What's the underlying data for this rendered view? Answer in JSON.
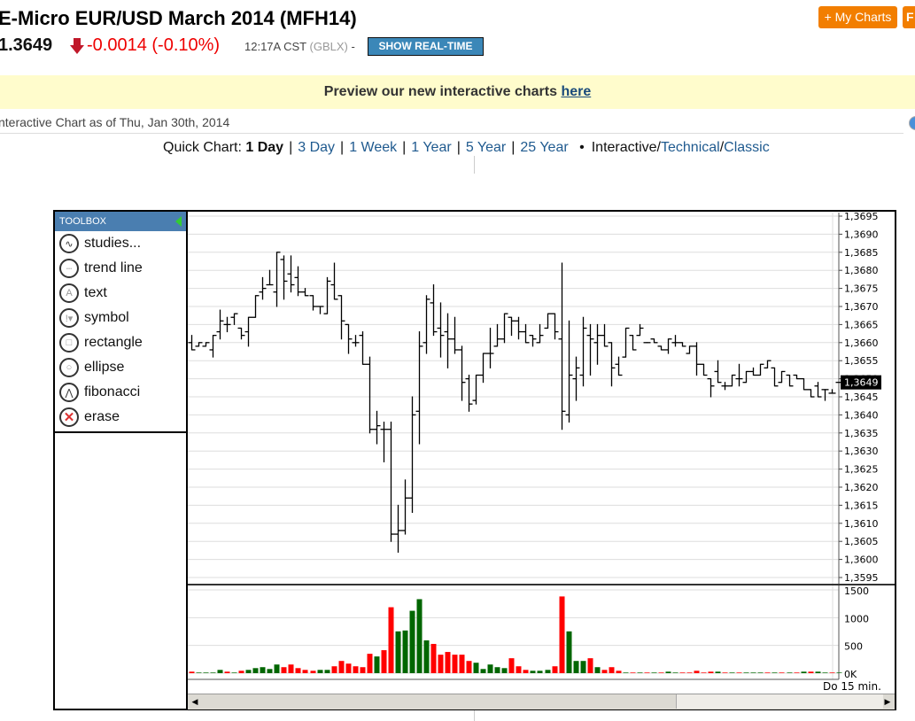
{
  "header": {
    "title": "E-Micro EUR/USD March 2014 (MFH14)",
    "last": "1.3649",
    "change": "-0.0014 (-0.10%)",
    "time": "12:17A CST",
    "exchange": "(GBLX)",
    "dash": "-",
    "realtime_button": "SHOW REAL-TIME",
    "my_charts": "+ My Charts",
    "other_button": "F"
  },
  "banner": {
    "text": "Preview our new interactive charts ",
    "link": "here"
  },
  "as_of": "nteractive Chart as of Thu, Jan 30th, 2014",
  "quick": {
    "label": "Quick Chart:",
    "active": "1 Day",
    "links": [
      "3 Day",
      "1 Week",
      "1 Year",
      "5 Year",
      "25 Year"
    ],
    "bullet": "•",
    "interactive": "Interactive",
    "technical": "Technical",
    "classic": "Classic",
    "slash": "/",
    "bar": "|"
  },
  "toolbox": {
    "title": "TOOLBOX",
    "items": [
      {
        "label": "studies...",
        "icon": "studies-icon"
      },
      {
        "label": "trend line",
        "icon": "trend-line-icon"
      },
      {
        "label": "text",
        "icon": "text-icon"
      },
      {
        "label": "symbol",
        "icon": "symbol-icon"
      },
      {
        "label": "rectangle",
        "icon": "rectangle-icon"
      },
      {
        "label": "ellipse",
        "icon": "ellipse-icon"
      },
      {
        "label": "fibonacci",
        "icon": "fibonacci-icon"
      },
      {
        "label": "erase",
        "icon": "erase-icon"
      }
    ]
  },
  "footer": {
    "label": "Do  15 min."
  },
  "colors": {
    "up": "#006600",
    "down": "#ff0000",
    "accent": "#f27e00"
  },
  "chart_data": {
    "type": "ohlc",
    "interval": "15 min.",
    "price_ticks": [
      "1,3695",
      "1,3690",
      "1,3685",
      "1,3680",
      "1,3675",
      "1,3670",
      "1,3665",
      "1,3660",
      "1,3655",
      "1,3650",
      "1,3645",
      "1,3640",
      "1,3635",
      "1,3630",
      "1,3625",
      "1,3620",
      "1,3615",
      "1,3610",
      "1,3605",
      "1,3600",
      "1,3595"
    ],
    "ylim": [
      1.3595,
      1.3695
    ],
    "current_label": "1,3649",
    "current": 1.3649,
    "volume_ticks": [
      "1500",
      "1000",
      "500",
      "0K"
    ],
    "volume_ylim": [
      0,
      1500
    ],
    "ohlc": [
      [
        1.366,
        1.3662,
        1.3658,
        1.3658
      ],
      [
        1.3659,
        1.366,
        1.3659,
        1.366
      ],
      [
        1.3659,
        1.366,
        1.3659,
        1.366
      ],
      [
        1.3658,
        1.3662,
        1.3656,
        1.3662
      ],
      [
        1.3663,
        1.3669,
        1.3661,
        1.3666
      ],
      [
        1.3665,
        1.3667,
        1.3663,
        1.3665
      ],
      [
        1.3667,
        1.3668,
        1.3665,
        1.3668
      ],
      [
        1.3664,
        1.3664,
        1.3661,
        1.3662
      ],
      [
        1.3663,
        1.3667,
        1.3659,
        1.3667
      ],
      [
        1.3667,
        1.3673,
        1.3667,
        1.3673
      ],
      [
        1.3674,
        1.3678,
        1.3672,
        1.3675
      ],
      [
        1.3676,
        1.368,
        1.3676,
        1.3676
      ],
      [
        1.3674,
        1.3685,
        1.367,
        1.3685
      ],
      [
        1.3683,
        1.3684,
        1.3672,
        1.3677
      ],
      [
        1.3679,
        1.3684,
        1.3674,
        1.3676
      ],
      [
        1.3678,
        1.3681,
        1.3673,
        1.3674
      ],
      [
        1.3674,
        1.3675,
        1.3673,
        1.3673
      ],
      [
        1.3673,
        1.3673,
        1.3669,
        1.367
      ],
      [
        1.367,
        1.367,
        1.3668,
        1.367
      ],
      [
        1.3668,
        1.3678,
        1.3668,
        1.3677
      ],
      [
        1.3676,
        1.3682,
        1.3672,
        1.3672
      ],
      [
        1.3673,
        1.3673,
        1.3661,
        1.3666
      ],
      [
        1.3665,
        1.3665,
        1.3657,
        1.3661
      ],
      [
        1.366,
        1.3662,
        1.3659,
        1.366
      ],
      [
        1.3662,
        1.3663,
        1.3654,
        1.3654
      ],
      [
        1.3654,
        1.3656,
        1.3635,
        1.3636
      ],
      [
        1.3636,
        1.3641,
        1.3632,
        1.3637
      ],
      [
        1.3636,
        1.3638,
        1.3627,
        1.3636
      ],
      [
        1.3636,
        1.3638,
        1.3605,
        1.3607
      ],
      [
        1.3607,
        1.3615,
        1.3602,
        1.3608
      ],
      [
        1.3608,
        1.3622,
        1.3607,
        1.3617
      ],
      [
        1.3617,
        1.3645,
        1.3613,
        1.364
      ],
      [
        1.3641,
        1.3663,
        1.3632,
        1.3659
      ],
      [
        1.366,
        1.3673,
        1.3657,
        1.3672
      ],
      [
        1.3671,
        1.3676,
        1.3662,
        1.3663
      ],
      [
        1.3664,
        1.3671,
        1.3656,
        1.3662
      ],
      [
        1.3663,
        1.3668,
        1.3653,
        1.3661
      ],
      [
        1.3661,
        1.3667,
        1.3657,
        1.3658
      ],
      [
        1.3658,
        1.3659,
        1.3644,
        1.3649
      ],
      [
        1.365,
        1.3651,
        1.3641,
        1.3643
      ],
      [
        1.3644,
        1.3651,
        1.3643,
        1.3651
      ],
      [
        1.3651,
        1.3657,
        1.3649,
        1.3657
      ],
      [
        1.3657,
        1.3664,
        1.3653,
        1.3657
      ],
      [
        1.3659,
        1.3665,
        1.3659,
        1.3661
      ],
      [
        1.3661,
        1.3668,
        1.366,
        1.3668
      ],
      [
        1.3667,
        1.3667,
        1.3662,
        1.3666
      ],
      [
        1.3666,
        1.3667,
        1.3661,
        1.3663
      ],
      [
        1.3663,
        1.3665,
        1.366,
        1.366
      ],
      [
        1.3662,
        1.3662,
        1.3659,
        1.3661
      ],
      [
        1.366,
        1.3665,
        1.366,
        1.3662
      ],
      [
        1.3664,
        1.3668,
        1.3664,
        1.3668
      ],
      [
        1.3668,
        1.3668,
        1.3661,
        1.3663
      ],
      [
        1.3661,
        1.3682,
        1.3636,
        1.3641
      ],
      [
        1.364,
        1.3666,
        1.3638,
        1.3651
      ],
      [
        1.365,
        1.3656,
        1.3644,
        1.3653
      ],
      [
        1.3651,
        1.3667,
        1.3648,
        1.3664
      ],
      [
        1.3662,
        1.3665,
        1.3651,
        1.3661
      ],
      [
        1.366,
        1.3665,
        1.3654,
        1.3662
      ],
      [
        1.3662,
        1.3665,
        1.3659,
        1.3659
      ],
      [
        1.366,
        1.366,
        1.3648,
        1.3653
      ],
      [
        1.3654,
        1.3656,
        1.3651,
        1.3651
      ],
      [
        1.3656,
        1.3664,
        1.3656,
        1.3664
      ],
      [
        1.3662,
        1.3662,
        1.3658,
        1.3658
      ],
      [
        1.3662,
        1.3665,
        1.3662,
        1.3664
      ],
      [
        1.366,
        1.366,
        1.366,
        1.366
      ],
      [
        1.3661,
        1.3661,
        1.366,
        1.366
      ],
      [
        1.3659,
        1.3659,
        1.3658,
        1.3658
      ],
      [
        1.3658,
        1.3661,
        1.3657,
        1.3661
      ],
      [
        1.366,
        1.3662,
        1.3659,
        1.366
      ],
      [
        1.366,
        1.366,
        1.3659,
        1.3659
      ],
      [
        1.3657,
        1.3659,
        1.3657,
        1.3659
      ],
      [
        1.3659,
        1.366,
        1.3651,
        1.3654
      ],
      [
        1.3654,
        1.3654,
        1.3651,
        1.3651
      ],
      [
        1.365,
        1.365,
        1.3645,
        1.3648
      ],
      [
        1.3652,
        1.3655,
        1.3649,
        1.3649
      ],
      [
        1.3648,
        1.3649,
        1.3647,
        1.3648
      ],
      [
        1.3648,
        1.3651,
        1.3648,
        1.3651
      ],
      [
        1.365,
        1.3654,
        1.3648,
        1.365
      ],
      [
        1.3649,
        1.3652,
        1.3649,
        1.3652
      ],
      [
        1.3652,
        1.3653,
        1.3651,
        1.3651
      ],
      [
        1.3651,
        1.3654,
        1.3651,
        1.3654
      ],
      [
        1.3653,
        1.3655,
        1.3653,
        1.3655
      ],
      [
        1.3653,
        1.3653,
        1.3648,
        1.3648
      ],
      [
        1.3649,
        1.3652,
        1.3649,
        1.3652
      ],
      [
        1.3651,
        1.3651,
        1.3648,
        1.3648
      ],
      [
        1.3651,
        1.3651,
        1.365,
        1.365
      ],
      [
        1.365,
        1.365,
        1.3647,
        1.3647
      ],
      [
        1.3647,
        1.3647,
        1.3645,
        1.3645
      ],
      [
        1.3648,
        1.3649,
        1.3645,
        1.3645
      ],
      [
        1.3647,
        1.3647,
        1.3644,
        1.3647
      ],
      [
        1.3646,
        1.3647,
        1.3646,
        1.3646
      ],
      [
        1.3649,
        1.3649,
        1.3649,
        1.3649
      ]
    ],
    "volume": [
      27,
      11,
      11,
      11,
      59,
      27,
      11,
      43,
      59,
      91,
      108,
      75,
      156,
      108,
      156,
      91,
      59,
      43,
      59,
      59,
      124,
      220,
      172,
      124,
      108,
      349,
      301,
      414,
      1188,
      753,
      769,
      1124,
      1333,
      591,
      527,
      333,
      382,
      333,
      333,
      220,
      188,
      75,
      156,
      108,
      91,
      269,
      124,
      59,
      43,
      43,
      59,
      124,
      1382,
      753,
      220,
      220,
      269,
      108,
      59,
      108,
      43,
      11,
      11,
      11,
      11,
      11,
      11,
      27,
      11,
      11,
      11,
      43,
      11,
      27,
      27,
      11,
      11,
      11,
      11,
      11,
      11,
      11,
      11,
      11,
      11,
      11,
      27,
      27,
      27,
      11,
      11,
      11
    ],
    "volume_up": [
      0,
      1,
      1,
      1,
      1,
      0,
      1,
      0,
      1,
      1,
      1,
      1,
      1,
      0,
      0,
      0,
      0,
      0,
      1,
      1,
      0,
      0,
      0,
      0,
      0,
      0,
      1,
      0,
      0,
      1,
      1,
      1,
      1,
      1,
      0,
      0,
      0,
      0,
      0,
      0,
      1,
      1,
      1,
      1,
      1,
      0,
      0,
      0,
      1,
      1,
      1,
      0,
      0,
      1,
      1,
      1,
      0,
      1,
      0,
      0,
      0,
      1,
      0,
      1,
      0,
      1,
      0,
      1,
      1,
      0,
      0,
      0,
      0,
      0,
      1,
      0,
      1,
      0,
      1,
      1,
      1,
      0,
      1,
      0,
      1,
      0,
      1,
      0,
      1,
      1,
      0,
      1
    ]
  }
}
